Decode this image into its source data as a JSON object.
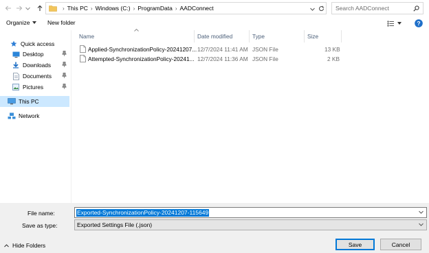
{
  "address": {
    "breadcrumb": [
      "This PC",
      "Windows (C:)",
      "ProgramData",
      "AADConnect"
    ],
    "search_placeholder": "Search AADConnect"
  },
  "toolbar": {
    "organize_label": "Organize",
    "new_folder_label": "New folder"
  },
  "nav": {
    "quick_access": "Quick access",
    "items": [
      {
        "label": "Desktop",
        "icon": "desktop-icon",
        "pinned": true
      },
      {
        "label": "Downloads",
        "icon": "downloads-icon",
        "pinned": true
      },
      {
        "label": "Documents",
        "icon": "documents-icon",
        "pinned": true
      },
      {
        "label": "Pictures",
        "icon": "pictures-icon",
        "pinned": true
      }
    ],
    "this_pc": "This PC",
    "network": "Network"
  },
  "columns": {
    "name": "Name",
    "date_modified": "Date modified",
    "type": "Type",
    "size": "Size"
  },
  "files": [
    {
      "name": "Applied-SynchronizationPolicy-20241207...",
      "date": "12/7/2024 11:41 AM",
      "type": "JSON File",
      "size": "13 KB"
    },
    {
      "name": "Attempted-SynchronizationPolicy-20241...",
      "date": "12/7/2024 11:36 AM",
      "type": "JSON File",
      "size": "2 KB"
    }
  ],
  "dialog": {
    "file_name_label": "File name:",
    "file_name_value": "Exported-SynchronizationPolicy-20241207-115649",
    "save_as_type_label": "Save as type:",
    "save_as_type_value": "Exported Settings File (.json)",
    "hide_folders_label": "Hide Folders",
    "save_label": "Save",
    "cancel_label": "Cancel"
  },
  "colors": {
    "selection": "#0078d7",
    "nav_selected": "#cce8ff",
    "header_text": "#4c607a",
    "help": "#1e6fc9",
    "folder": "#f2c55c"
  }
}
